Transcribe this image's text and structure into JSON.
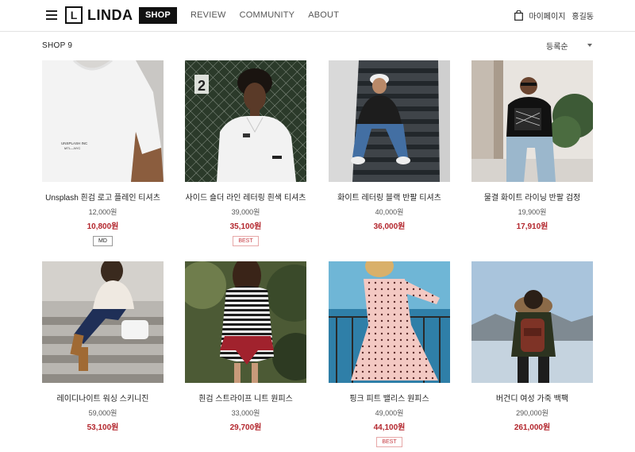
{
  "header": {
    "logo_mark": "L",
    "logo_text": "LINDA",
    "nav": [
      "SHOP",
      "REVIEW",
      "COMMUNITY",
      "ABOUT"
    ],
    "mypage": "마이페이지",
    "user": "홍길동"
  },
  "toolbar": {
    "title": "SHOP 9",
    "sort": "등록순"
  },
  "products": [
    {
      "name": "Unsplash 흰검 로고 플레인 티셔츠",
      "price": "12,000원",
      "sale": "10,800원",
      "badge": "MD"
    },
    {
      "name": "사이드 숄더 라인 레터링 흰색 티셔츠",
      "price": "39,000원",
      "sale": "35,100원",
      "badge": "BEST"
    },
    {
      "name": "화이트 레터링 블랙 반팔 티셔츠",
      "price": "40,000원",
      "sale": "36,000원",
      "badge": ""
    },
    {
      "name": "물결 화이트 라이닝 반팔 검정",
      "price": "19,900원",
      "sale": "17,910원",
      "badge": ""
    },
    {
      "name": "레이디나이트 워싱 스키니진",
      "price": "59,000원",
      "sale": "53,100원",
      "badge": ""
    },
    {
      "name": "흰검 스트라이프 니트 원피스",
      "price": "33,000원",
      "sale": "29,700원",
      "badge": ""
    },
    {
      "name": "핑크 피트 밸리스 원피스",
      "price": "49,000원",
      "sale": "44,100원",
      "badge": "BEST"
    },
    {
      "name": "버건디 여성 가죽 백팩",
      "price": "290,000원",
      "sale": "261,000원",
      "badge": ""
    }
  ],
  "product_thumb_texts": [
    "UNSPLASH INC",
    "MTL—NYC",
    "2"
  ]
}
